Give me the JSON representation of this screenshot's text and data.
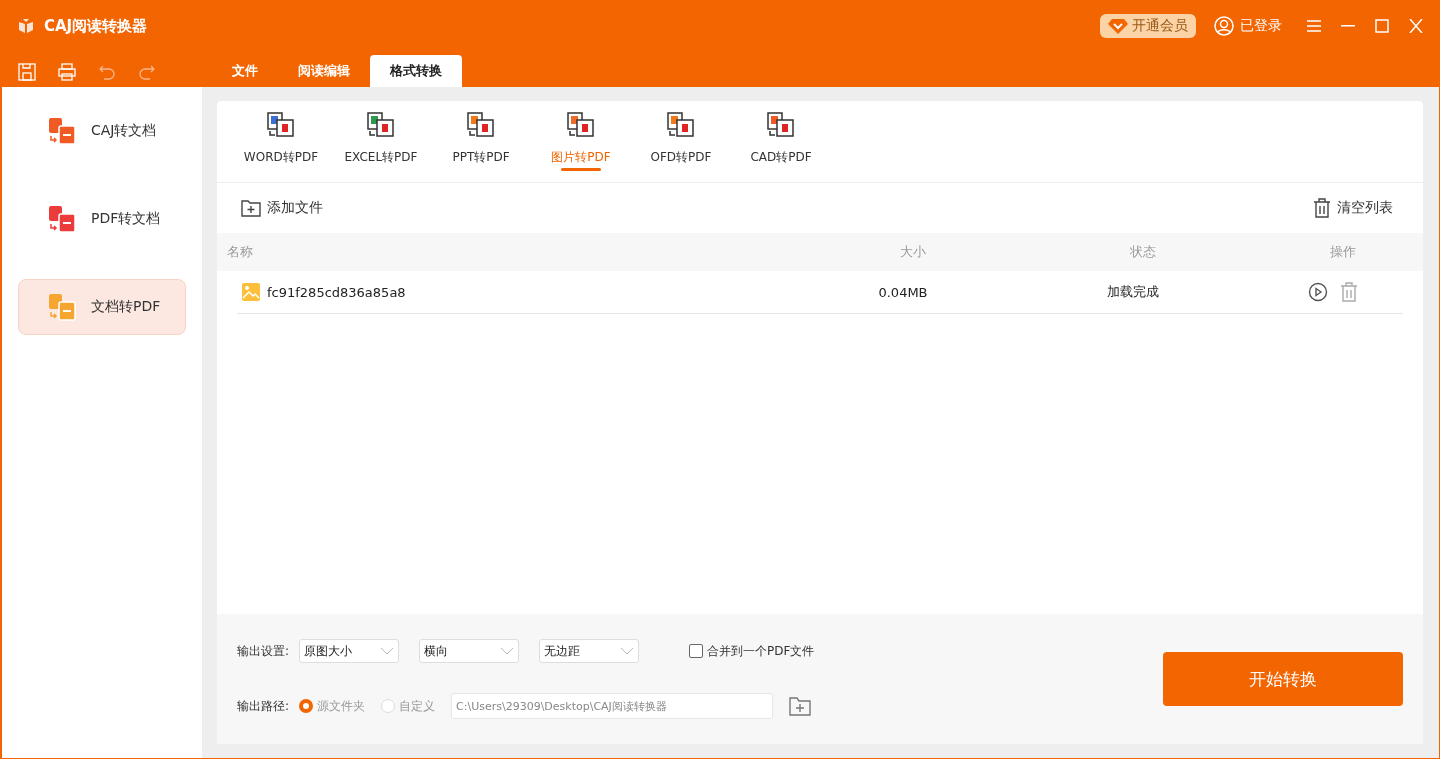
{
  "window": {
    "title": "CAJ阅读转换器",
    "vip": "开通会员",
    "account": "已登录"
  },
  "menu_tabs": [
    {
      "label": "文件",
      "selected": false
    },
    {
      "label": "阅读编辑",
      "selected": false
    },
    {
      "label": "格式转换",
      "selected": true
    }
  ],
  "sidebar": {
    "items": [
      {
        "label": "CAJ转文档",
        "selected": false,
        "color": "#f05a24"
      },
      {
        "label": "PDF转文档",
        "selected": false,
        "color": "#ec3b3b"
      },
      {
        "label": "文档转PDF",
        "selected": true,
        "color": "#f7a531"
      }
    ]
  },
  "format_tabs": [
    {
      "label": "WORD转PDF",
      "selected": false,
      "color": "#3b6fd6"
    },
    {
      "label": "EXCEL转PDF",
      "selected": false,
      "color": "#2e9a4f"
    },
    {
      "label": "PPT转PDF",
      "selected": false,
      "color": "#f07a1a"
    },
    {
      "label": "图片转PDF",
      "selected": true,
      "color": "#f26a2a"
    },
    {
      "label": "OFD转PDF",
      "selected": false,
      "color": "#f07a1a"
    },
    {
      "label": "CAD转PDF",
      "selected": false,
      "color": "#f05a24"
    }
  ],
  "toolbar": {
    "add": "添加文件",
    "clear": "清空列表"
  },
  "table": {
    "columns": [
      "名称",
      "大小",
      "状态",
      "操作"
    ],
    "rows": [
      {
        "name": "fc91f285cd836a85a8",
        "size": "0.04MB",
        "status": "加载完成"
      }
    ]
  },
  "output": {
    "settings_label": "输出设置:",
    "selects": [
      "原图大小",
      "横向",
      "无边距"
    ],
    "merge": {
      "label": "合并到一个PDF文件",
      "checked": false
    },
    "path_label": "输出路径:",
    "radios": [
      {
        "label": "源文件夹",
        "selected": true
      },
      {
        "label": "自定义",
        "selected": false
      }
    ],
    "path": "C:\\Users\\29309\\Desktop\\CAJ阅读转换器"
  },
  "start_button": "开始转换"
}
